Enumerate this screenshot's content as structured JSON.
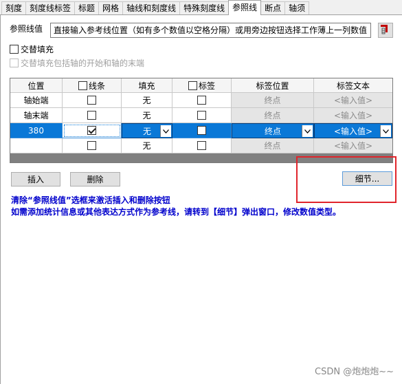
{
  "tabs": [
    "刻度",
    "刻度线标签",
    "标题",
    "网格",
    "轴线和刻度线",
    "特殊刻度线",
    "参照线",
    "断点",
    "轴须"
  ],
  "active_tab": "参照线",
  "ref": {
    "label": "参照线值",
    "placeholder": "直接输入参考线位置（如有多个数值以空格分隔）或用旁边按钮选择工作薄上一列数值",
    "pick_icon": "select-range-icon"
  },
  "options": {
    "alternate_fill": "交替填充",
    "alternate_fill_include": "交替填充包括轴的开始和轴的末端"
  },
  "grid": {
    "headers": [
      "位置",
      "线条",
      "填充",
      "标签",
      "标签位置",
      "标签文本"
    ],
    "rows": [
      {
        "position": "轴始端",
        "line": false,
        "fill": "无",
        "label": false,
        "label_pos": "终点",
        "label_text": "<输入值>"
      },
      {
        "position": "轴末端",
        "line": false,
        "fill": "无",
        "label": false,
        "label_pos": "终点",
        "label_text": "<输入值>"
      },
      {
        "position": "380",
        "line": true,
        "fill": "无",
        "label": false,
        "label_pos": "终点",
        "label_text": "<输入值>",
        "selected": true
      },
      {
        "position": "",
        "line": false,
        "fill": "无",
        "label": false,
        "label_pos": "终点",
        "label_text": "<输入值>"
      }
    ]
  },
  "buttons": {
    "insert": "插入",
    "delete": "删除",
    "detail": "细节..."
  },
  "info": {
    "line1": "清除“参照线值”选框来激活插入和删除按钮",
    "line2": "如需添加统计信息或其他表达方式作为参考线，请转到【细节】弹出窗口，修改数值类型。"
  },
  "watermark": "CSDN @炮炮炮~~",
  "colors": {
    "selection": "#0a78d7",
    "info_text": "#0000cc",
    "highlight": "#e0242b"
  }
}
